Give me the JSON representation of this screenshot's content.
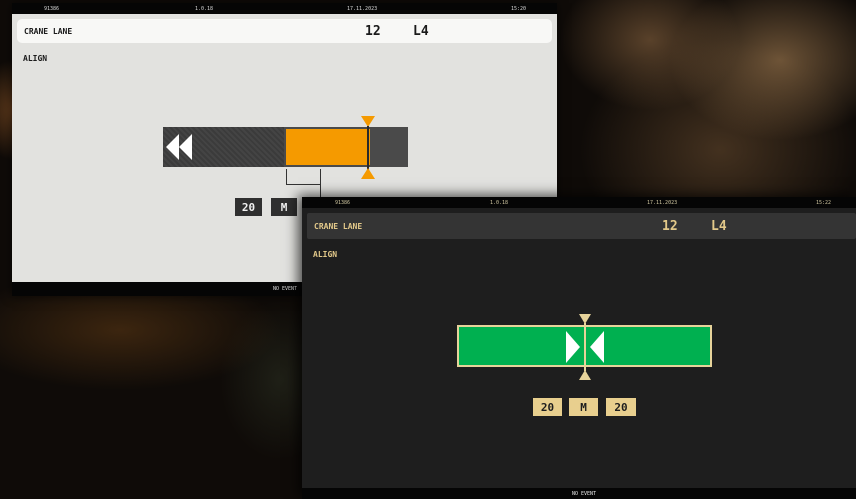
{
  "light_screen": {
    "status": {
      "left": "91386",
      "version": "1.0.18",
      "date": "17.11.2023",
      "time": "15:20"
    },
    "header": {
      "title": "CRANE LANE",
      "number": "12",
      "lane": "L4"
    },
    "mode": "ALIGN",
    "chips": [
      "20",
      "M"
    ],
    "footer": "NO EVENT",
    "colors": {
      "background": "#e2e2df",
      "indicator": "#f59a00",
      "bar": "#4a4a4a"
    }
  },
  "dark_screen": {
    "status": {
      "left": "91386",
      "version": "1.0.18",
      "date": "17.11.2023",
      "time": "15:22"
    },
    "header": {
      "title": "CRANE LANE",
      "number": "12",
      "lane": "L4"
    },
    "mode": "ALIGN",
    "chips": [
      "20",
      "M",
      "20"
    ],
    "footer": "NO EVENT",
    "colors": {
      "background": "#1e1e1e",
      "indicator": "#00b050",
      "accent": "#e8cf8e"
    }
  },
  "icons": {
    "light": [
      "rewind-icon",
      "position-marker-icon"
    ],
    "dark": [
      "align-center-icon",
      "position-marker-icon"
    ]
  }
}
